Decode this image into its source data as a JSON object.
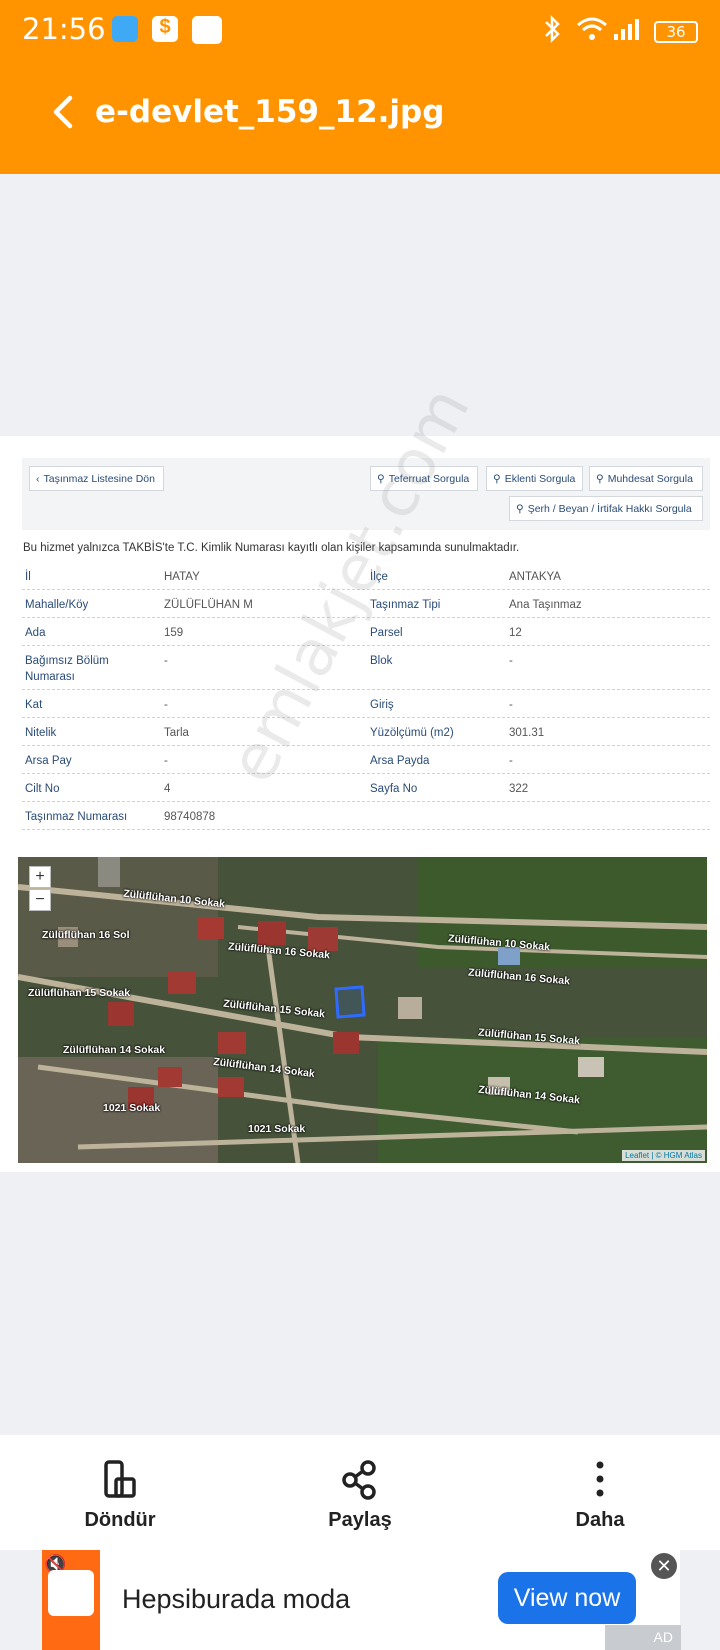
{
  "status_bar": {
    "time": "21:56",
    "battery": "36"
  },
  "app_bar": {
    "title": "e-devlet_159_12.jpg"
  },
  "document": {
    "back_button": "Taşınmaz Listesine Dön",
    "query_buttons": [
      "Teferruat Sorgula",
      "Eklenti Sorgula",
      "Muhdesat Sorgula",
      "Şerh / Beyan / İrtifak Hakkı Sorgula"
    ],
    "notice": "Bu hizmet yalnızca TAKBİS'te T.C. Kimlik Numarası kayıtlı olan kişiler kapsamında sunulmaktadır.",
    "fields": [
      {
        "k1": "İl",
        "v1": "HATAY",
        "k2": "İlçe",
        "v2": "ANTAKYA"
      },
      {
        "k1": "Mahalle/Köy",
        "v1": "ZÜLÜFLÜHAN M",
        "k2": "Taşınmaz Tipi",
        "v2": "Ana Taşınmaz"
      },
      {
        "k1": "Ada",
        "v1": "159",
        "k2": "Parsel",
        "v2": "12"
      },
      {
        "k1": "Bağımsız Bölüm Numarası",
        "v1": "-",
        "k2": "Blok",
        "v2": "-"
      },
      {
        "k1": "Kat",
        "v1": "-",
        "k2": "Giriş",
        "v2": "-"
      },
      {
        "k1": "Nitelik",
        "v1": "Tarla",
        "k2": "Yüzölçümü (m2)",
        "v2": "301.31"
      },
      {
        "k1": "Arsa Pay",
        "v1": "-",
        "k2": "Arsa Payda",
        "v2": "-"
      },
      {
        "k1": "Cilt No",
        "v1": "4",
        "k2": "Sayfa No",
        "v2": "322"
      },
      {
        "k1": "Taşınmaz Numarası",
        "v1": "98740878",
        "k2": "",
        "v2": ""
      }
    ],
    "watermark": "emlakjet.com",
    "map": {
      "zoom_in": "+",
      "zoom_out": "−",
      "attribution": "Leaflet | © HGM Atlas",
      "streets": [
        "Zülüflühan 10 Sokak",
        "Zülüflühan 16 Sol",
        "Zülüflühan 16 Sokak",
        "Zülüflühan 10 Sokak",
        "Zülüflühan 16 Sokak",
        "Zülüflühan 15 Sokak",
        "Zülüflühan 15 Sokak",
        "Zülüflühan 15 Sokak",
        "Zülüflühan 14 Sokak",
        "Zülüflühan 14 Sokak",
        "Zülüflühan 14 Sokak",
        "1021 Sokak",
        "1021 Sokak"
      ]
    }
  },
  "bottom_bar": {
    "rotate": "Döndür",
    "share": "Paylaş",
    "more": "Daha"
  },
  "ad": {
    "text": "Hepsiburada moda",
    "button": "View now",
    "close": "✕",
    "tag": "AD"
  },
  "colors": {
    "accent": "#ff9400",
    "link": "#2a4c78",
    "ad_button": "#1a73e8"
  }
}
